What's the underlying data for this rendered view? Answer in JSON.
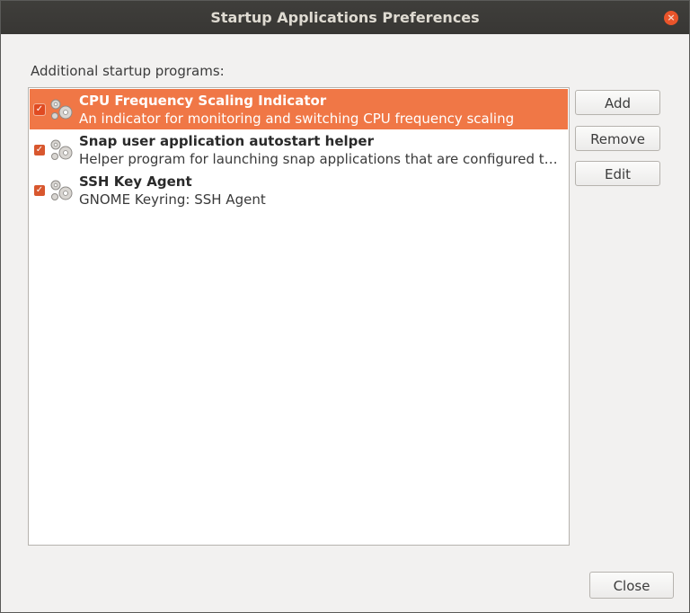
{
  "window": {
    "title": "Startup Applications Preferences",
    "close_glyph": "×"
  },
  "section_label": "Additional startup programs:",
  "programs": [
    {
      "name": "CPU Frequency Scaling Indicator",
      "description": "An indicator for monitoring and switching CPU frequency scaling",
      "enabled": true,
      "selected": true
    },
    {
      "name": "Snap user application autostart helper",
      "description": "Helper program for launching snap applications that are configured t…",
      "enabled": true,
      "selected": false
    },
    {
      "name": "SSH Key Agent",
      "description": "GNOME Keyring: SSH Agent",
      "enabled": true,
      "selected": false
    }
  ],
  "buttons": {
    "add": "Add",
    "remove": "Remove",
    "edit": "Edit",
    "close": "Close"
  },
  "icons": {
    "program": "gears-icon",
    "check": "✓"
  },
  "colors": {
    "selection": "#f07746",
    "checkbox": "#d8572e",
    "titlebar": "#3c3b37"
  }
}
